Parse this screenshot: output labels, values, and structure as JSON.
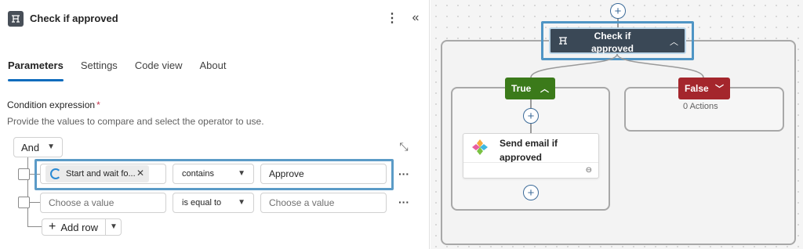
{
  "panel": {
    "title": "Check if approved",
    "tabs": [
      {
        "label": "Parameters",
        "active": true
      },
      {
        "label": "Settings",
        "active": false
      },
      {
        "label": "Code view",
        "active": false
      },
      {
        "label": "About",
        "active": false
      }
    ],
    "condition_label": "Condition expression",
    "required_mark": "*",
    "condition_desc": "Provide the values to compare and select the operator to use.",
    "group_operator": "And",
    "rows": [
      {
        "left_token": "Start and wait fo...",
        "operator": "contains",
        "right_value": "Approve"
      },
      {
        "left_placeholder": "Choose a value",
        "operator": "is equal to",
        "right_placeholder": "Choose a value"
      }
    ],
    "add_row_label": "Add row"
  },
  "canvas": {
    "condition_node": {
      "title": "Check if approved"
    },
    "true_branch": {
      "label": "True",
      "color": "#3b7a1a"
    },
    "false_branch": {
      "label": "False",
      "color": "#a4262c",
      "actions_text": "0 Actions"
    },
    "email_action": {
      "title": "Send email if approved"
    }
  },
  "colors": {
    "accent": "#0f6cbd",
    "highlight": "#5b9bc7",
    "node_bg": "#3a4856"
  }
}
